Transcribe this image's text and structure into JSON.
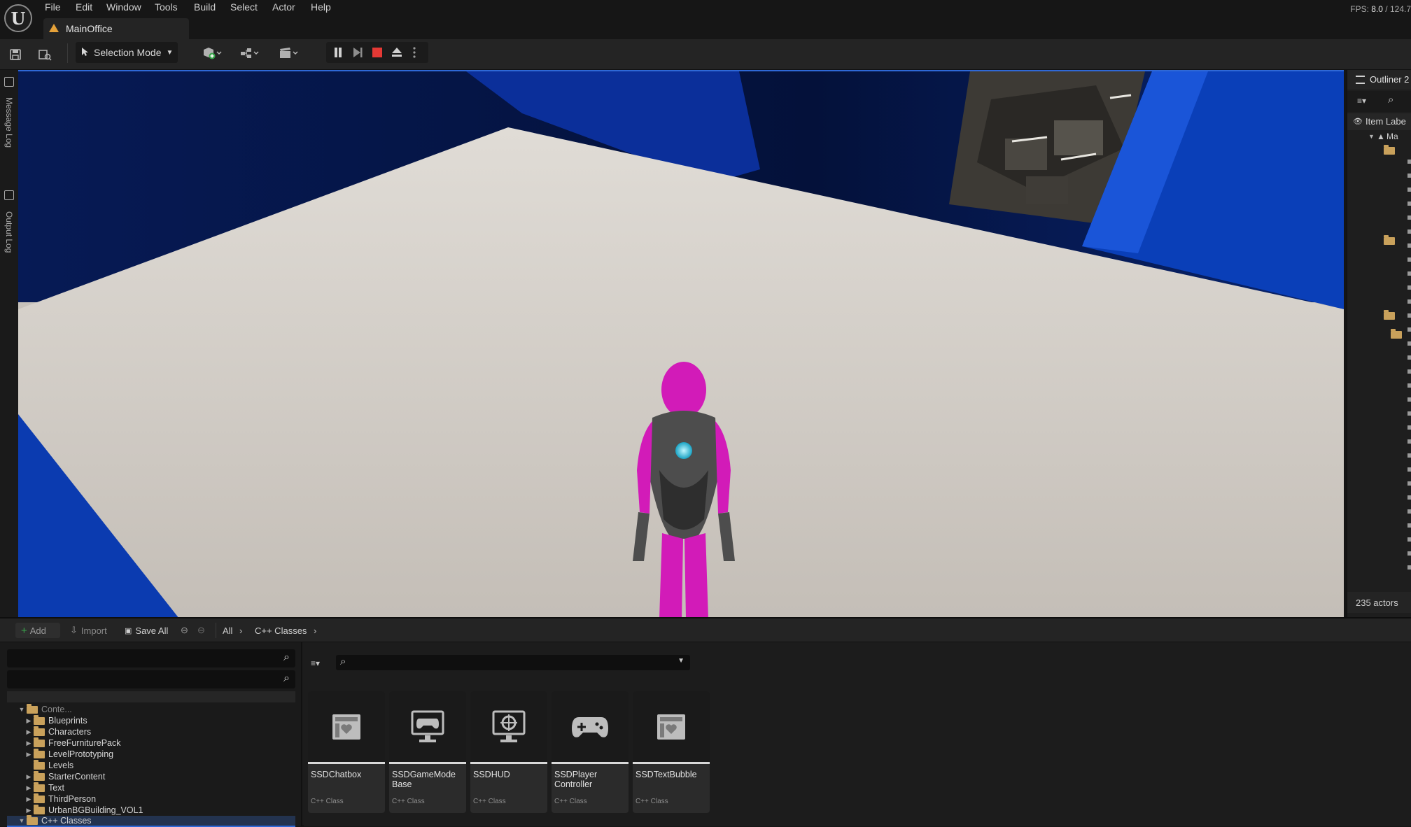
{
  "menu": {
    "items": [
      "File",
      "Edit",
      "Window",
      "Tools",
      "Build",
      "Select",
      "Actor",
      "Help"
    ]
  },
  "app": {
    "logo_text": "U",
    "tab_title": "MainOffice"
  },
  "stats": {
    "fps_label": "FPS:",
    "fps_value": "8.0",
    "ms_value": "/ 124.7"
  },
  "toolbar": {
    "selection_mode": "Selection Mode",
    "icons": [
      "save-icon",
      "browse-icon",
      "add-actor-icon",
      "blueprint-icon",
      "cinematics-icon",
      "pause-icon",
      "step-icon",
      "stop-icon",
      "eject-icon",
      "more-icon"
    ]
  },
  "side_tabs": {
    "message_log": "Message Log",
    "output_log": "Output Log"
  },
  "outliner": {
    "title": "Outliner 2",
    "column_label": "Item Labe",
    "tree_fragment": "Ma",
    "footer": "235 actors"
  },
  "content_browser": {
    "add_label": "Add",
    "import_label": "Import",
    "save_all_label": "Save All",
    "breadcrumb": [
      "All",
      "C++ Classes"
    ],
    "tree": {
      "root_label": "Conte...",
      "folders": [
        "Blueprints",
        "Characters",
        "FreeFurniturePack",
        "LevelPrototyping",
        "Levels",
        "StarterContent",
        "Text",
        "ThirdPerson",
        "UrbanBGBuilding_VOL1"
      ],
      "selected": "C++ Classes"
    },
    "assets": [
      {
        "name": "SSDChatbox",
        "type": "C++ Class",
        "icon": "widget-icon"
      },
      {
        "name": "SSDGameMode Base",
        "type": "C++ Class",
        "icon": "gamemode-icon"
      },
      {
        "name": "SSDHUD",
        "type": "C++ Class",
        "icon": "hud-icon"
      },
      {
        "name": "SSDPlayer Controller",
        "type": "C++ Class",
        "icon": "gamepad-icon"
      },
      {
        "name": "SSDTextBubble",
        "type": "C++ Class",
        "icon": "widget-icon"
      }
    ]
  },
  "colors": {
    "accent": "#2f68d6",
    "folder": "#c9a15b",
    "character_pink": "#d21bb8",
    "wall_blue": "#0a3fb8",
    "stop_red": "#e53935"
  }
}
